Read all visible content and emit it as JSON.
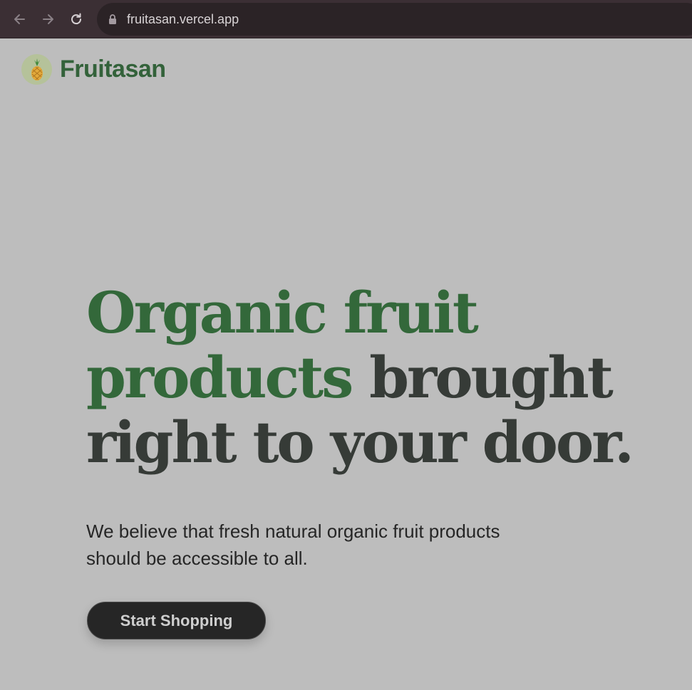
{
  "browser": {
    "url": "fruitasan.vercel.app",
    "back_icon": "arrow-left-icon",
    "forward_icon": "arrow-right-icon",
    "reload_icon": "reload-icon",
    "lock_icon": "lock-icon"
  },
  "header": {
    "logo_icon": "pineapple-icon",
    "brand": "Fruitasan"
  },
  "hero": {
    "headline_accent": "Organic fruit products",
    "headline_rest": "brought right to your door.",
    "subtext": "We believe that fresh natural organic fruit products should be accessible to all.",
    "cta_label": "Start Shopping"
  },
  "colors": {
    "page_background": "#bdbdbd",
    "brand_green": "#33683a",
    "headline_dark": "#363b37",
    "button_background": "#262626",
    "browser_bar": "#3b2f34"
  }
}
